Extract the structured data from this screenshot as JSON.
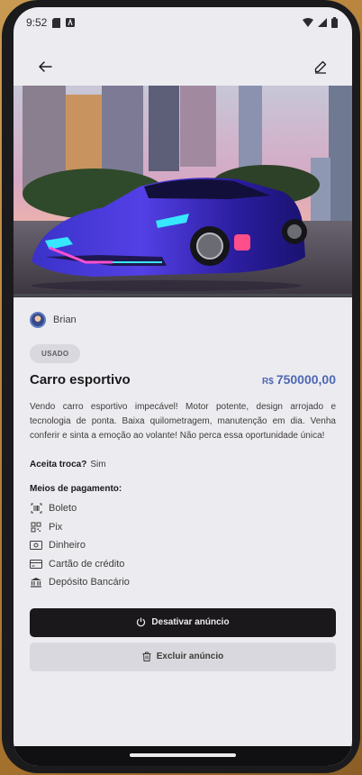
{
  "status": {
    "time": "9:52"
  },
  "listing": {
    "user_name": "Brian",
    "condition": "USADO",
    "title": "Carro esportivo",
    "currency": "R$",
    "price": "750000,00",
    "description": "Vendo carro esportivo impecável! Motor potente, design arrojado e tecnologia de ponta. Baixa quilometragem, manutenção em dia. Venha conferir e sinta a emoção ao volante! Não perca essa oportunidade única!",
    "trade_label": "Aceita troca?",
    "trade_value": "Sim",
    "payment_title": "Meios de pagamento:",
    "payment_methods": [
      {
        "label": "Boleto",
        "icon": "barcode-icon"
      },
      {
        "label": "Pix",
        "icon": "qr-code-icon"
      },
      {
        "label": "Dinheiro",
        "icon": "money-icon"
      },
      {
        "label": "Cartão de crédito",
        "icon": "credit-card-icon"
      },
      {
        "label": "Depósito Bancário",
        "icon": "bank-icon"
      }
    ]
  },
  "actions": {
    "deactivate_label": "Desativar anúncio",
    "delete_label": "Excluir anúncio"
  },
  "colors": {
    "accent": "#4f67b4",
    "dark": "#1a181b",
    "background": "#ececf0"
  }
}
